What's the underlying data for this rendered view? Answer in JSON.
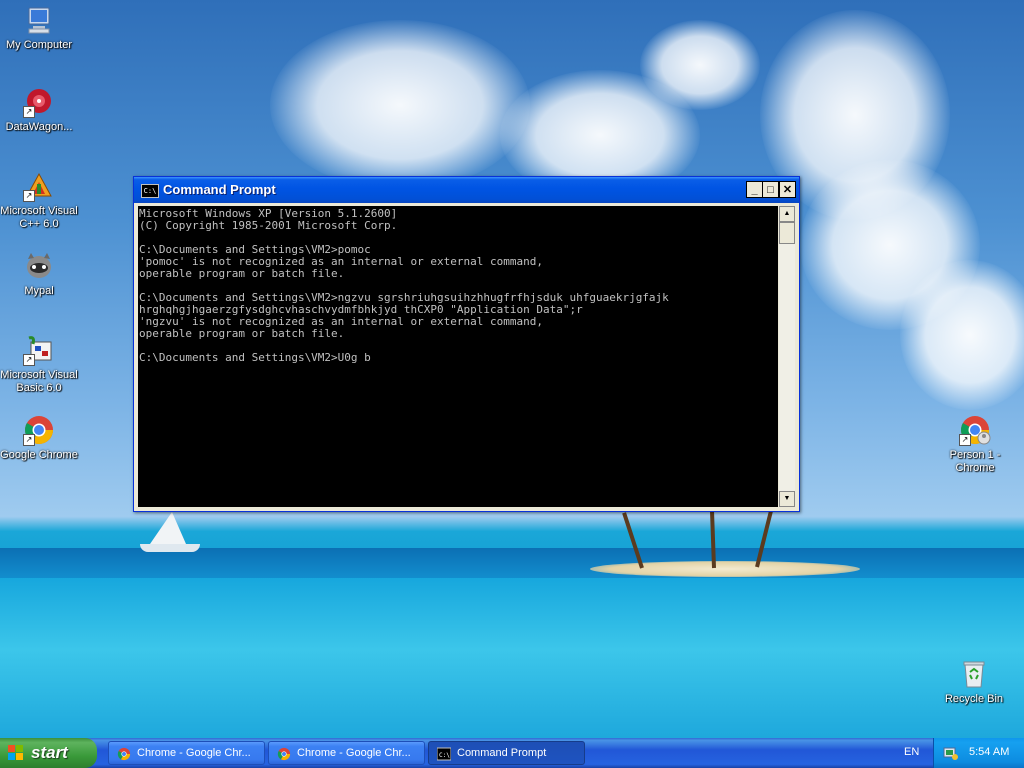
{
  "desktop": {
    "icons": [
      {
        "label": "My Computer",
        "icon": "my-computer-icon"
      },
      {
        "label": "DataWagon...",
        "icon": "datawagon-icon"
      },
      {
        "label": "Microsoft Visual C++ 6.0",
        "icon": "visual-cpp-icon"
      },
      {
        "label": "Mypal",
        "icon": "mypal-icon"
      },
      {
        "label": "Microsoft Visual Basic 6.0",
        "icon": "visual-basic-icon"
      },
      {
        "label": "Google Chrome",
        "icon": "chrome-icon"
      },
      {
        "label": "Person 1 - Chrome",
        "icon": "chrome-person-icon"
      },
      {
        "label": "Recycle Bin",
        "icon": "recycle-bin-icon"
      }
    ]
  },
  "cmd_window": {
    "title": "Command Prompt",
    "icon_glyph": "C:\\",
    "buttons": {
      "minimize": "_",
      "maximize": "□",
      "close": "✕"
    },
    "lines": [
      "Microsoft Windows XP [Version 5.1.2600]",
      "(C) Copyright 1985-2001 Microsoft Corp.",
      "",
      "C:\\Documents and Settings\\VM2>pomoc",
      "'pomoc' is not recognized as an internal or external command,",
      "operable program or batch file.",
      "",
      "C:\\Documents and Settings\\VM2>ngzvu sgrshriuhgsuihzhhugfrfhjsduk uhfguaekrjgfajk",
      "hrghqhgjhgaerzgfysdghcvhaschvydmfbhkjyd thCXP0 \"Application Data\";r",
      "'ngzvu' is not recognized as an internal or external command,",
      "operable program or batch file.",
      "",
      "C:\\Documents and Settings\\VM2>U0g b"
    ],
    "scroll": {
      "up": "▲",
      "down": "▼"
    }
  },
  "taskbar": {
    "start_label": "start",
    "tasks": [
      {
        "label": "Chrome - Google Chr...",
        "icon": "chrome-icon",
        "active": false
      },
      {
        "label": "Chrome - Google Chr...",
        "icon": "chrome-icon",
        "active": false
      },
      {
        "label": "Command Prompt",
        "icon": "command-prompt-icon",
        "active": true
      }
    ],
    "language": "EN",
    "clock": "5:54 AM"
  }
}
